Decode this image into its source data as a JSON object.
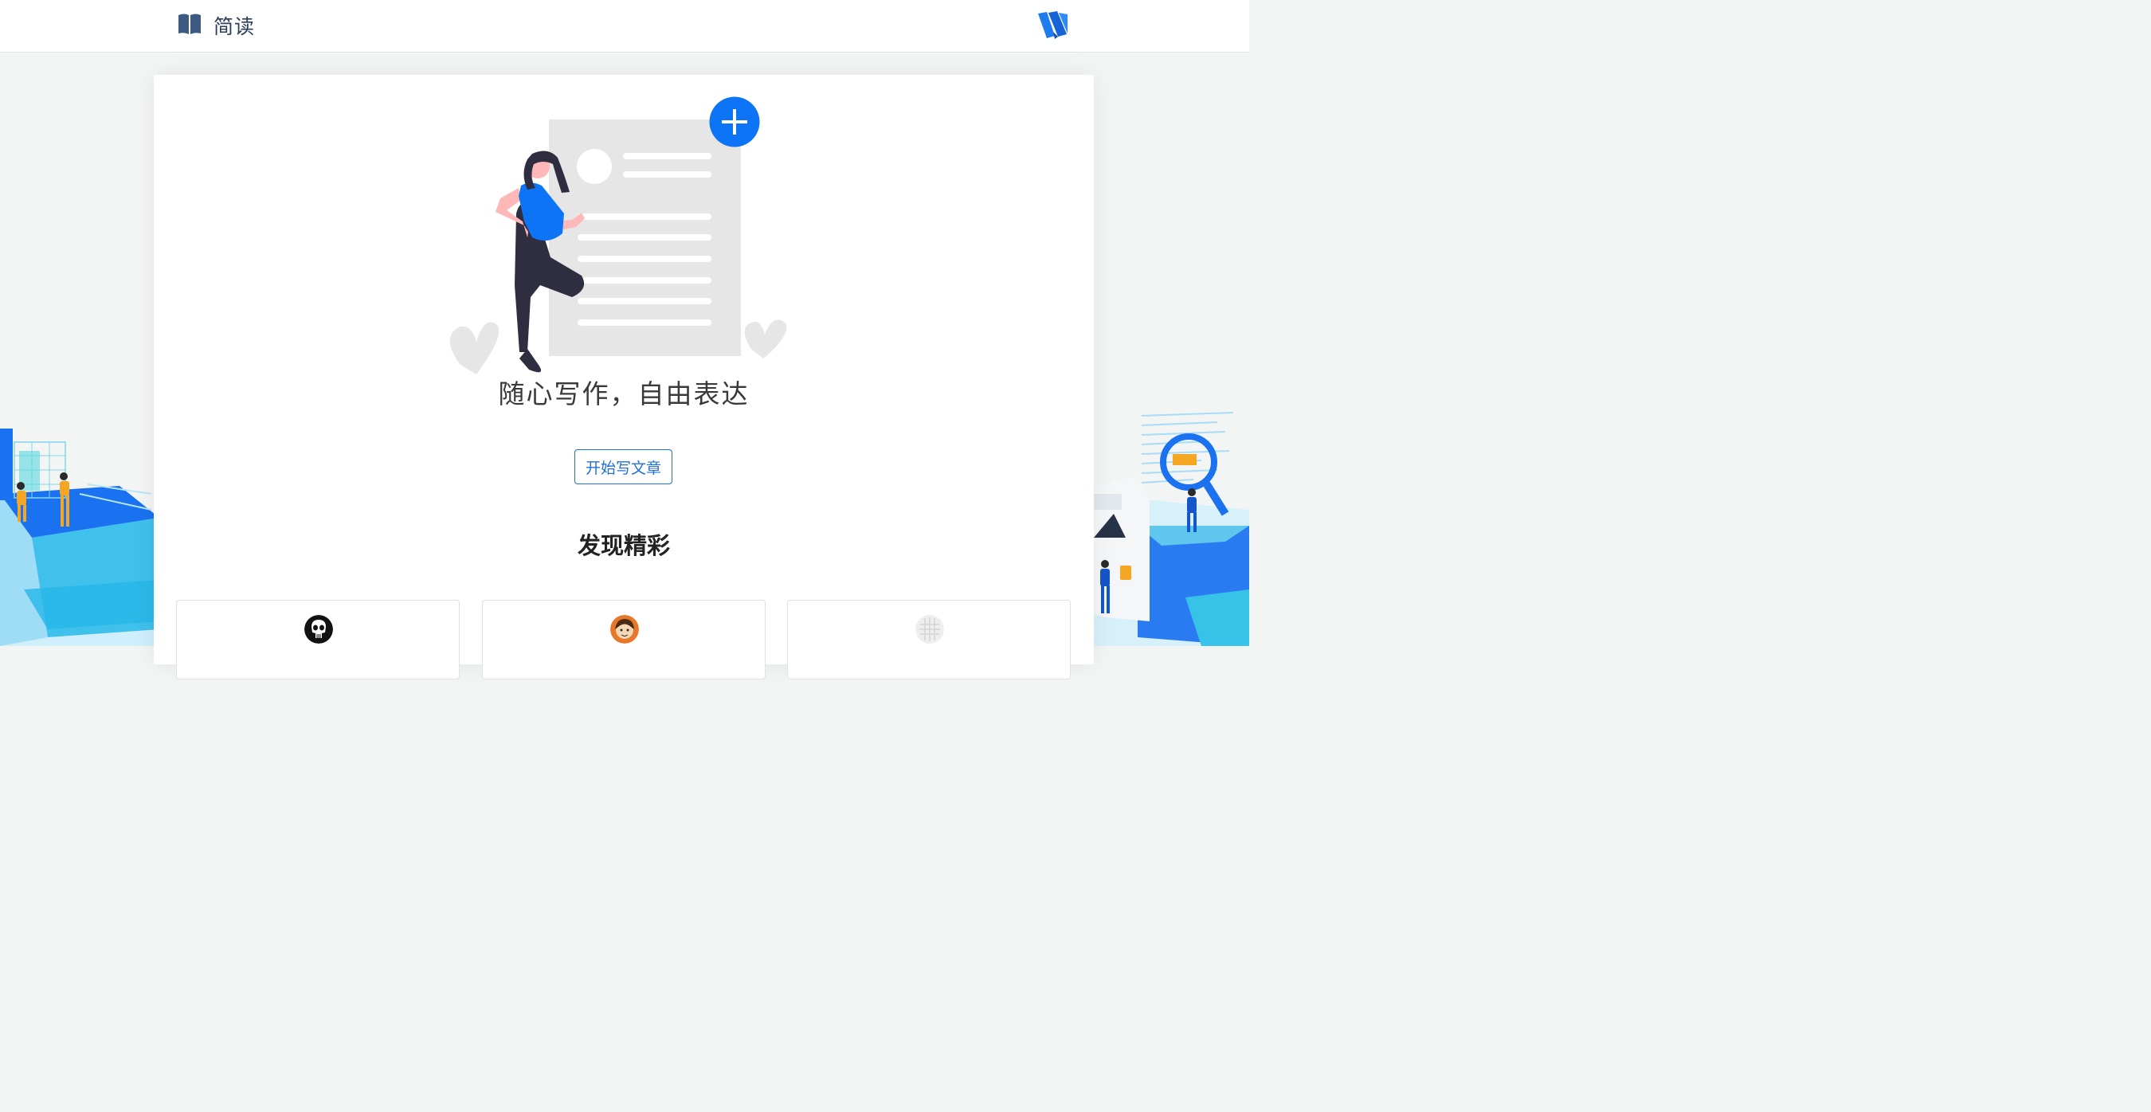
{
  "nav": {
    "brand_name": "简读",
    "brand_icon": "open-book-icon",
    "logo_icon": "blue-ribbon-logo-icon"
  },
  "hero": {
    "illustration": "woman-with-document-plus-illustration",
    "slogan": "随心写作，自由表达",
    "write_button": "开始写文章"
  },
  "discover": {
    "title": "发现精彩",
    "cards": [
      {
        "avatar_icon": "skull-avatar"
      },
      {
        "avatar_icon": "cartoon-person-avatar"
      },
      {
        "avatar_icon": "gray-pattern-avatar"
      }
    ]
  },
  "colors": {
    "accent": "#1f6fd8",
    "brand_text": "#2c3e5a",
    "hero_blue": "#0d74f5"
  }
}
